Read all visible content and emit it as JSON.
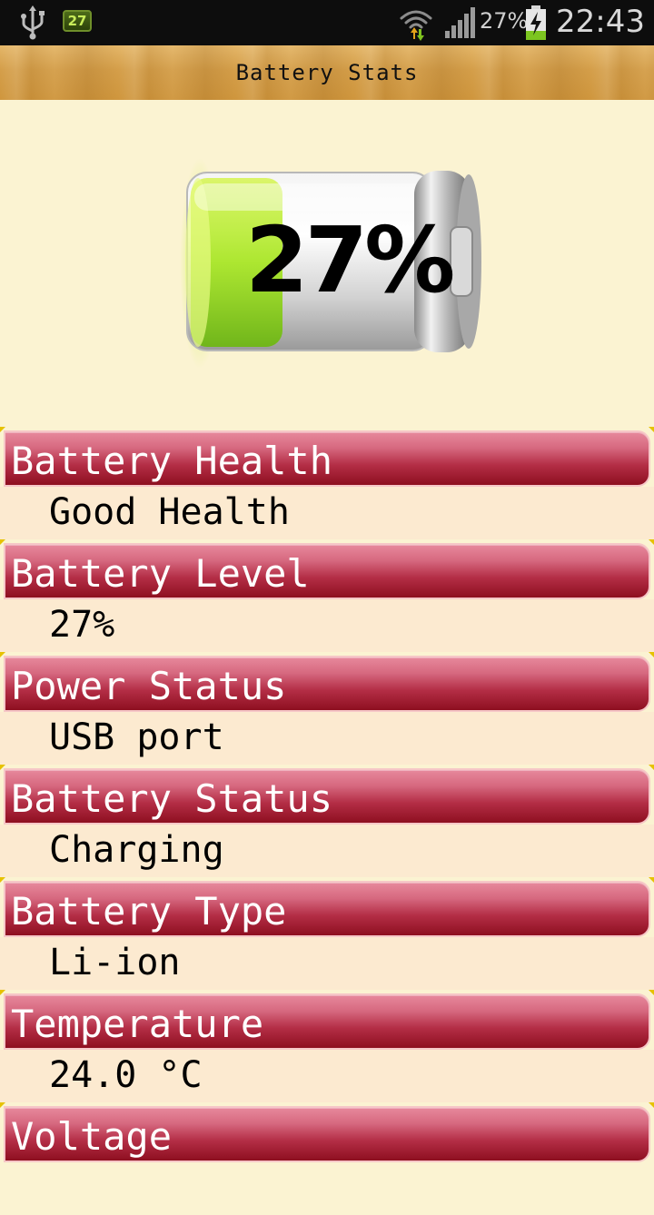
{
  "status_bar": {
    "notification_badge": "27",
    "battery_percent": "27%",
    "time": "22:43",
    "icons": [
      "usb-icon",
      "notification-badge-icon",
      "wifi-icon",
      "signal-icon",
      "battery-charging-icon"
    ]
  },
  "app": {
    "title": "Battery Stats"
  },
  "hero": {
    "percent_text": "27%",
    "level_fraction": 0.27,
    "fill_color": "#9ee21a"
  },
  "stats": [
    {
      "label": "Battery Health",
      "value": "Good Health"
    },
    {
      "label": "Battery Level",
      "value": "27%"
    },
    {
      "label": "Power Status",
      "value": "USB port"
    },
    {
      "label": "Battery Status",
      "value": "Charging"
    },
    {
      "label": "Battery Type",
      "value": "Li-ion"
    },
    {
      "label": "Temperature",
      "value": "24.0 °C"
    },
    {
      "label": "Voltage",
      "value": ""
    }
  ],
  "colors": {
    "header_top": "#e7899c",
    "header_bottom": "#8e0f20",
    "page_background": "#fbf3d2",
    "value_background": "#fcead0"
  }
}
